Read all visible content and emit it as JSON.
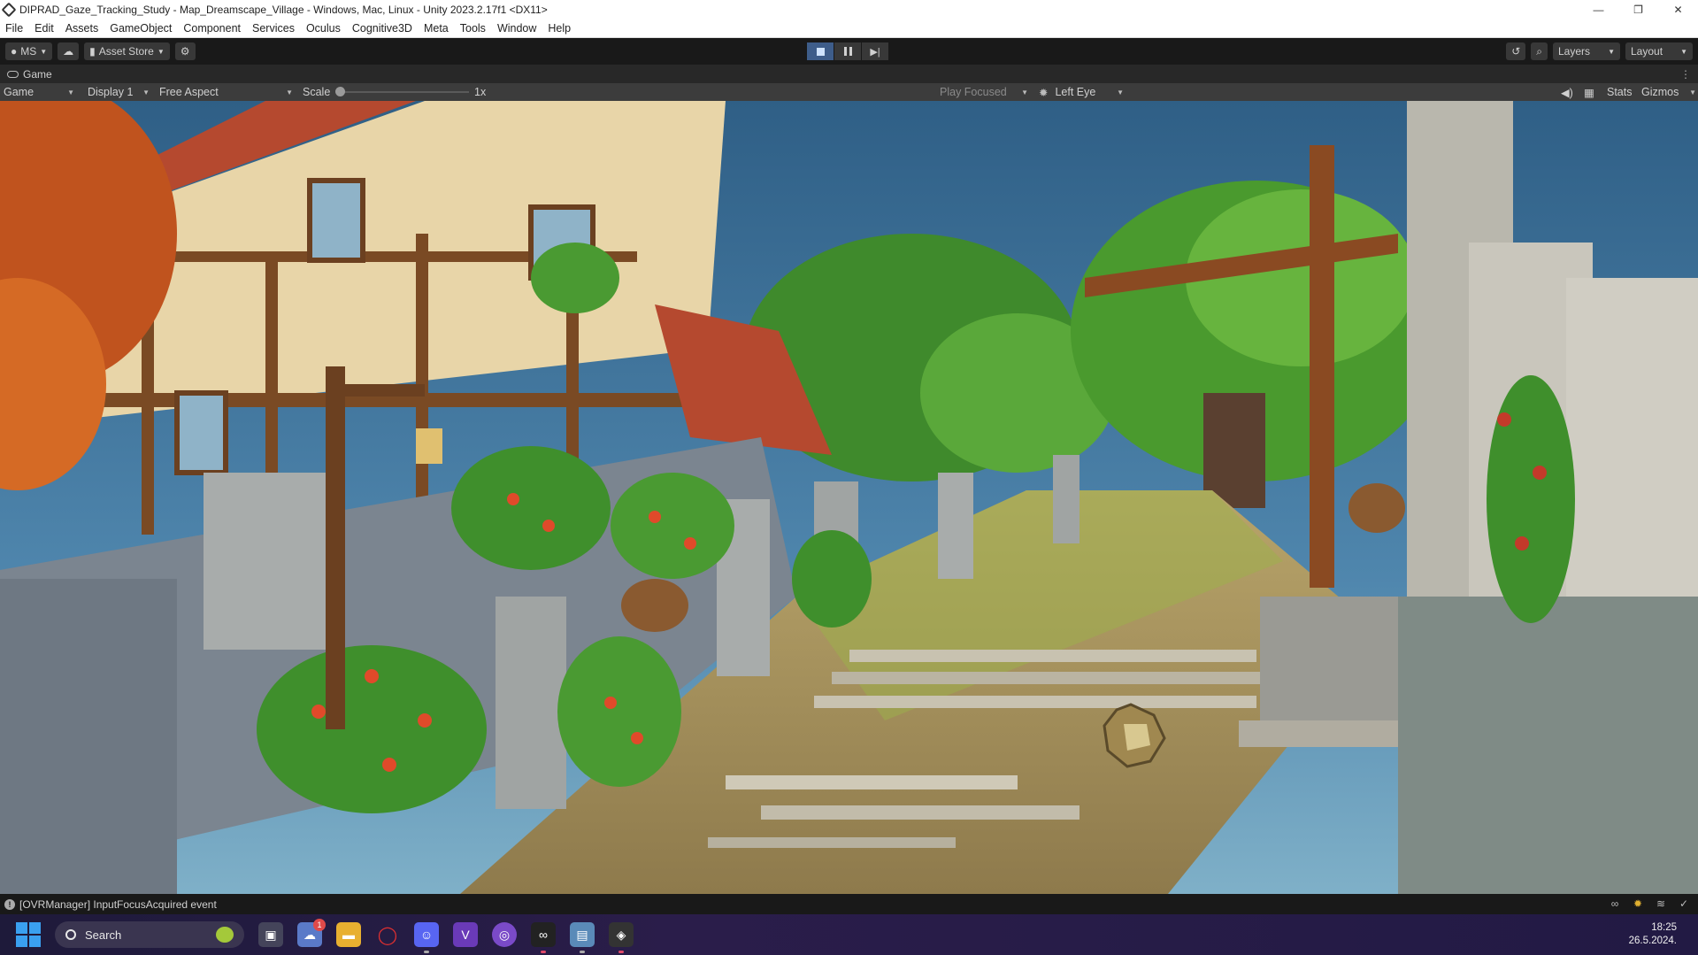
{
  "window": {
    "title": "DIPRAD_Gaze_Tracking_Study - Map_Dreamscape_Village - Windows, Mac, Linux - Unity 2023.2.17f1 <DX11>",
    "controls": {
      "minimize": "—",
      "restore": "❐",
      "close": "✕"
    }
  },
  "menu": [
    "File",
    "Edit",
    "Assets",
    "GameObject",
    "Component",
    "Services",
    "Oculus",
    "Cognitive3D",
    "Meta",
    "Tools",
    "Window",
    "Help"
  ],
  "toolbar": {
    "account": "MS",
    "asset_store": "Asset Store",
    "layers": "Layers",
    "layout": "Layout"
  },
  "game_view": {
    "tab_label": "Game",
    "view_mode": "Game",
    "display": "Display 1",
    "aspect": "Free Aspect",
    "scale_label": "Scale",
    "scale_value": "1x",
    "play_mode": "Play Focused",
    "eye": "Left Eye",
    "stats": "Stats",
    "gizmos": "Gizmos"
  },
  "status": {
    "message": "[OVRManager] InputFocusAcquired event"
  },
  "taskbar": {
    "search_label": "Search",
    "notification_count": "1",
    "time": "18:25",
    "date": "26.5.2024."
  },
  "colors": {
    "sky": "#3a6b93",
    "play_active": "#3e5d8a",
    "editor_bg": "#191919"
  },
  "icons": [
    "unity-icon",
    "cloud-icon",
    "asset-store-icon",
    "settings-icon",
    "stop-icon",
    "pause-icon",
    "step-icon",
    "history-icon",
    "search-icon",
    "gamepad-icon",
    "audio-icon",
    "grid-icon",
    "info-icon"
  ]
}
